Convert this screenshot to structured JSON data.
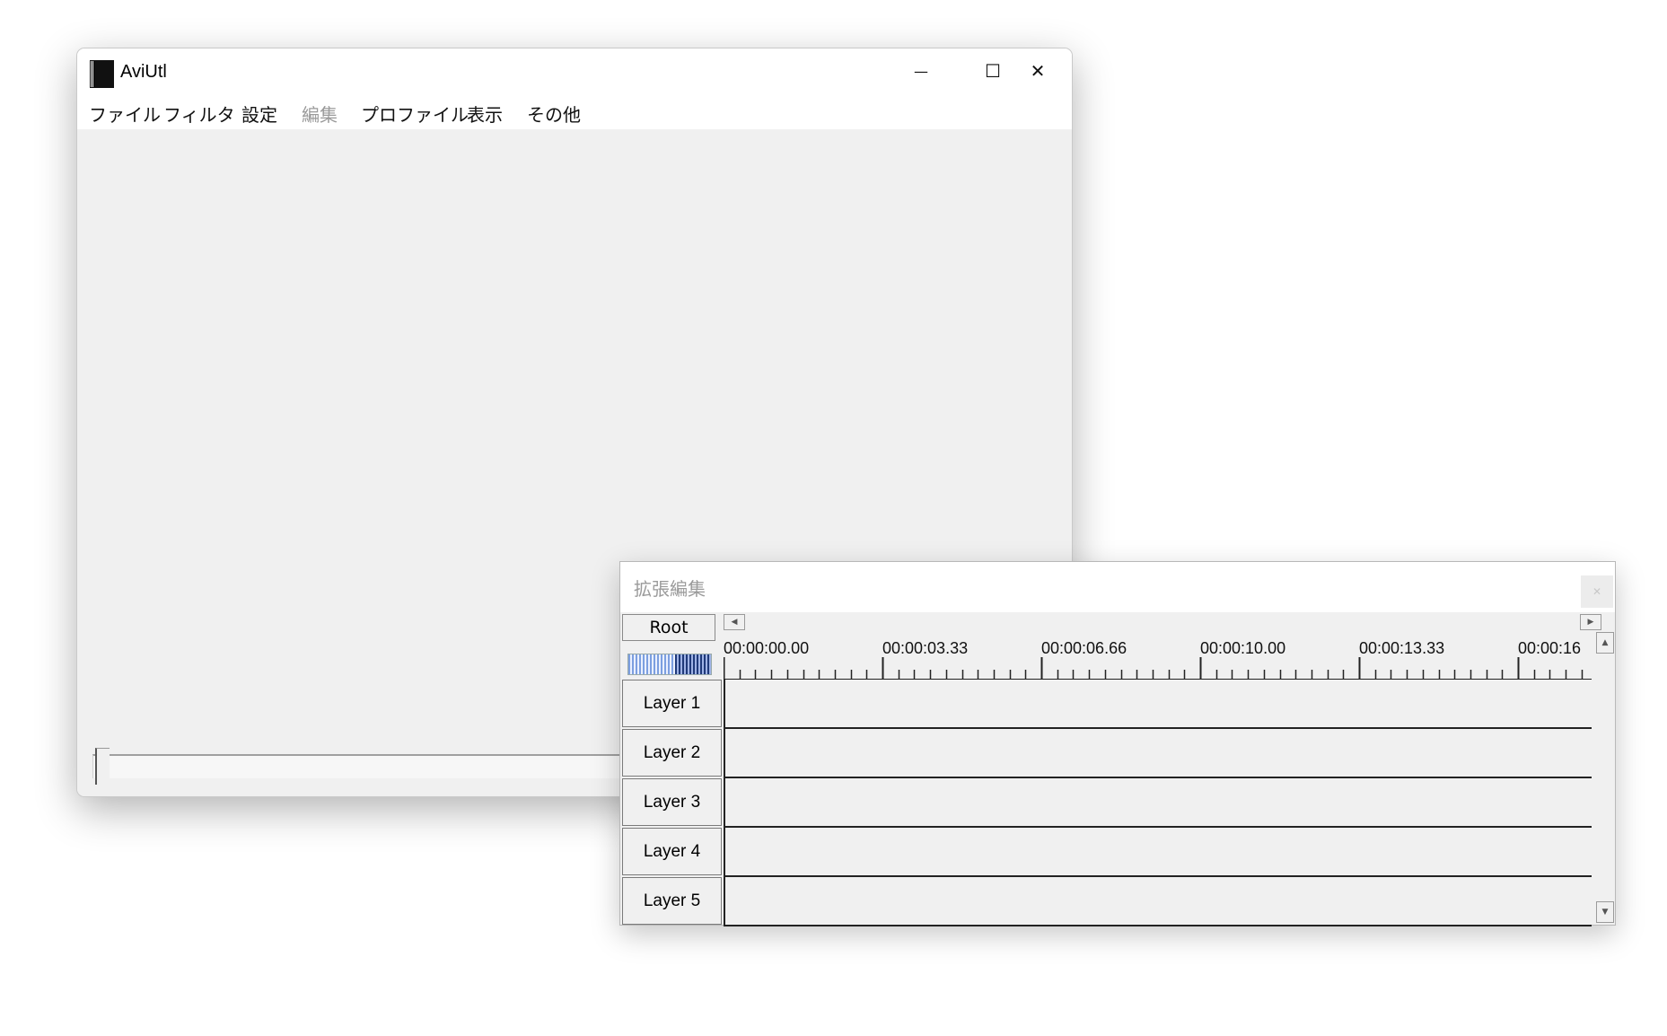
{
  "main_window": {
    "title": "AviUtl",
    "controls": {
      "minimize": "—",
      "maximize": "☐",
      "close": "✕"
    },
    "menu": [
      "ファイル",
      "フィルタ",
      "設定",
      "編集",
      "プロファイル",
      "表示",
      "その他"
    ],
    "disabled_menu_index": 3
  },
  "timeline_window": {
    "title": "拡張編集",
    "root_label": "Root",
    "ruler_labels": [
      "00:00:00.00",
      "00:00:03.33",
      "00:00:06.66",
      "00:00:10.00",
      "00:00:13.33",
      "00:00:16"
    ],
    "layers": [
      "Layer  1",
      "Layer  2",
      "Layer  3",
      "Layer  4",
      "Layer  5"
    ]
  },
  "colors": {
    "window_bg": "#f0f0f0",
    "titlebar_bg": "#ffffff",
    "disabled_text": "#9a9a9a",
    "zoom_light": "#7c9fe0",
    "zoom_dark": "#203a7a"
  }
}
